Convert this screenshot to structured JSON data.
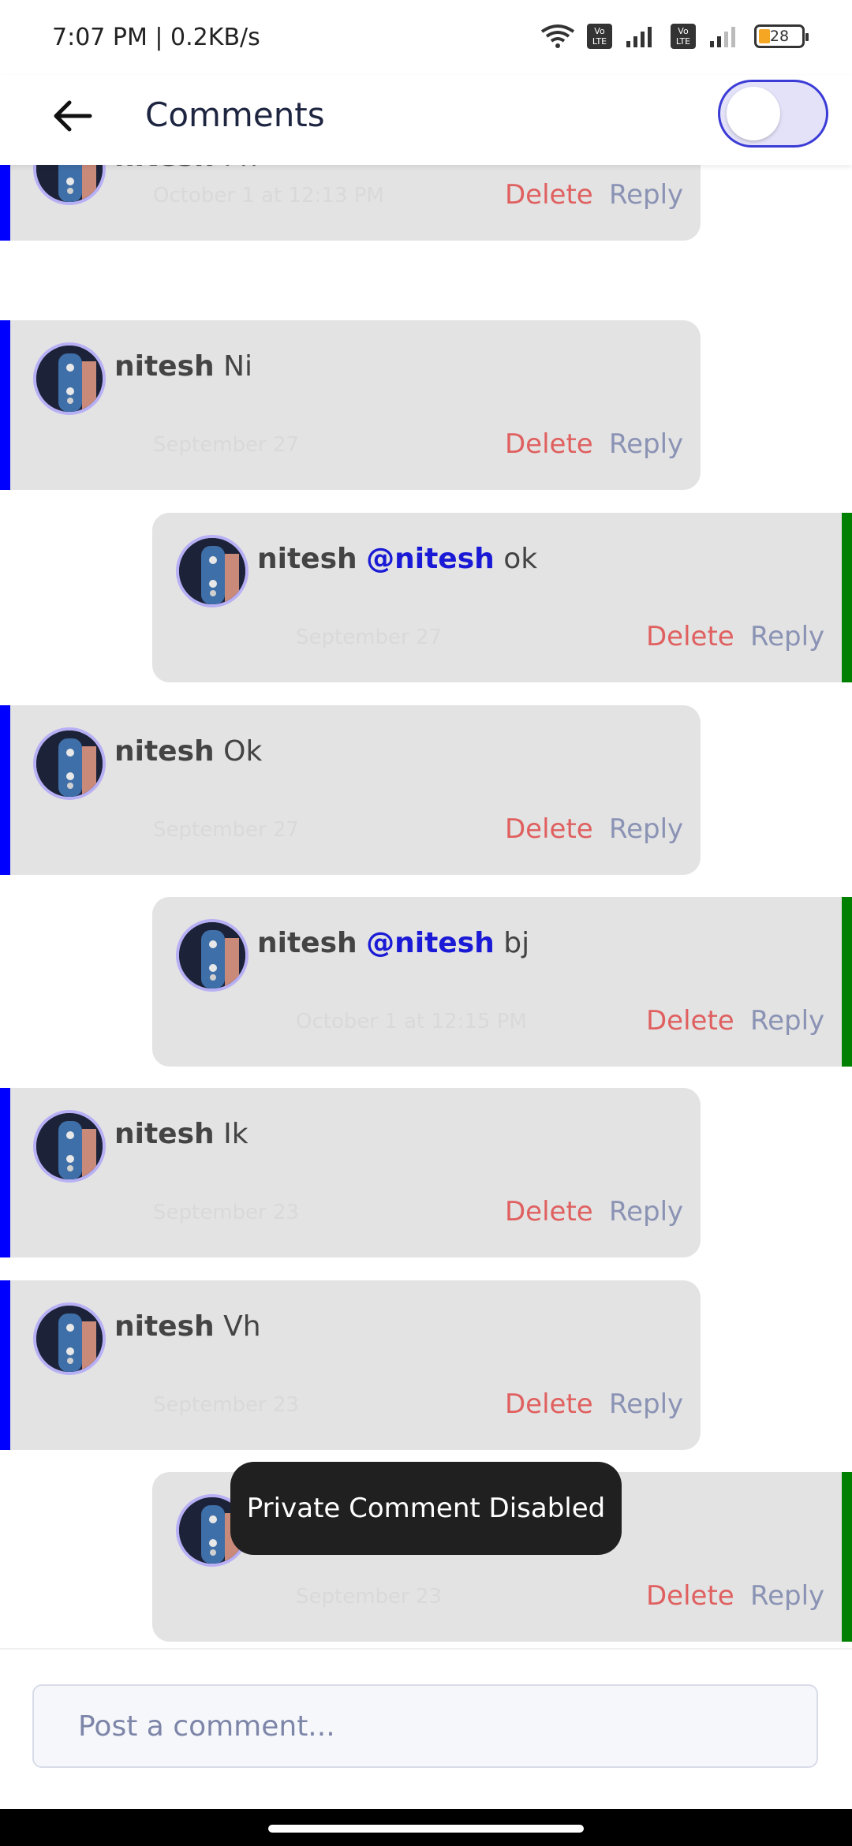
{
  "status_bar": {
    "time": "7:07 PM | 0.2KB/s",
    "lte1": "Vo LTE",
    "lte2": "Vo LTE",
    "battery": "28"
  },
  "header": {
    "title": "Comments",
    "toggle_state": "off"
  },
  "comments": [
    {
      "kind": "top",
      "user": "nitesh",
      "mention": "",
      "text": "Fh",
      "date": "October 1 at 12:13 PM",
      "delete": "Delete",
      "reply": "Reply"
    },
    {
      "kind": "top",
      "user": "nitesh",
      "mention": "",
      "text": "Ni",
      "date": "September 27",
      "delete": "Delete",
      "reply": "Reply"
    },
    {
      "kind": "reply",
      "user": "nitesh",
      "mention": "@nitesh",
      "text": "ok",
      "date": "September 27",
      "delete": "Delete",
      "reply": "Reply"
    },
    {
      "kind": "top",
      "user": "nitesh",
      "mention": "",
      "text": "Ok",
      "date": "September 27",
      "delete": "Delete",
      "reply": "Reply"
    },
    {
      "kind": "reply",
      "user": "nitesh",
      "mention": "@nitesh",
      "text": "bj",
      "date": "October 1 at 12:15 PM",
      "delete": "Delete",
      "reply": "Reply"
    },
    {
      "kind": "top",
      "user": "nitesh",
      "mention": "",
      "text": "Ik",
      "date": "September 23",
      "delete": "Delete",
      "reply": "Reply"
    },
    {
      "kind": "top",
      "user": "nitesh",
      "mention": "",
      "text": "Vh",
      "date": "September 23",
      "delete": "Delete",
      "reply": "Reply"
    },
    {
      "kind": "reply",
      "user": "",
      "mention": "",
      "text": "",
      "date": "September 23",
      "delete": "Delete",
      "reply": "Reply"
    }
  ],
  "toast": "Private Comment Disabled",
  "input": {
    "placeholder": "Post a comment...",
    "value": ""
  }
}
